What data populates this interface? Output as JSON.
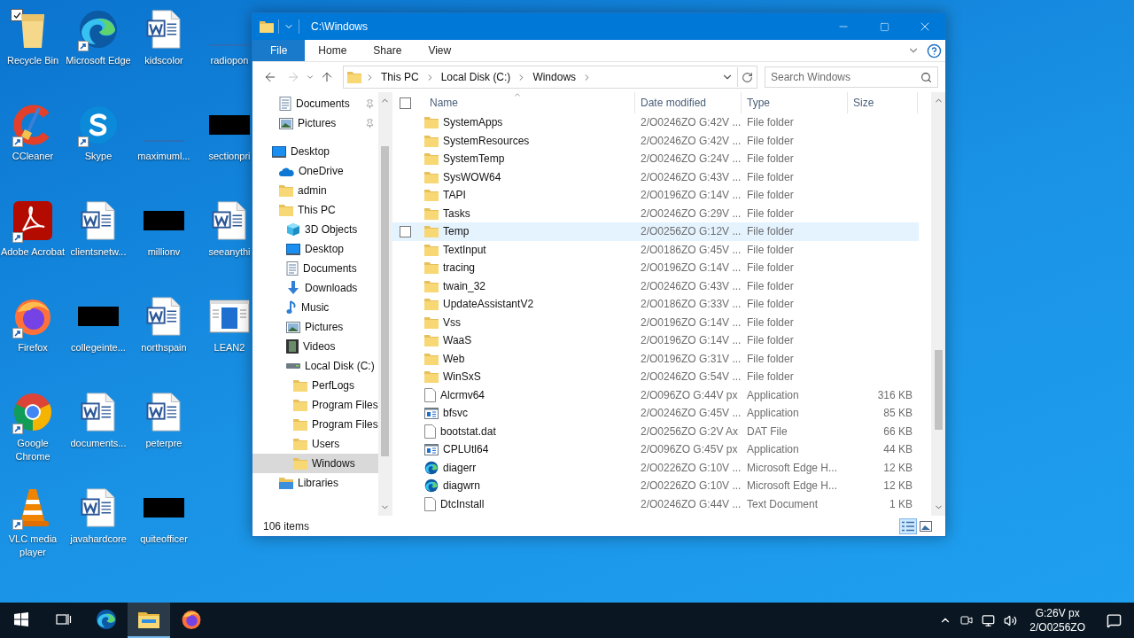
{
  "desktop": {
    "icons": [
      {
        "label": "Recycle Bin",
        "kind": "recycle",
        "shortcut": false,
        "checked": true
      },
      {
        "label": "CCleaner",
        "kind": "ccleaner",
        "shortcut": true,
        "checked": false
      },
      {
        "label": "Adobe Acrobat",
        "kind": "acrobat",
        "shortcut": true,
        "checked": false
      },
      {
        "label": "Firefox",
        "kind": "firefox",
        "shortcut": true,
        "checked": false
      },
      {
        "label": "Google Chrome",
        "kind": "chrome",
        "shortcut": true,
        "checked": false
      },
      {
        "label": "VLC media player",
        "kind": "vlc",
        "shortcut": true,
        "checked": false
      },
      {
        "label": "Microsoft Edge",
        "kind": "edge",
        "shortcut": true,
        "checked": false
      },
      {
        "label": "Skype",
        "kind": "skype",
        "shortcut": true,
        "checked": false
      },
      {
        "label": "clientsnetw...",
        "kind": "word",
        "shortcut": false,
        "checked": false
      },
      {
        "label": "collegeinte...",
        "kind": "redacted",
        "shortcut": false,
        "checked": false
      },
      {
        "label": "documents...",
        "kind": "word",
        "shortcut": false,
        "checked": false
      },
      {
        "label": "javahardcore",
        "kind": "word",
        "shortcut": false,
        "checked": false
      },
      {
        "label": "kidscolor",
        "kind": "word",
        "shortcut": false,
        "checked": false
      },
      {
        "label": "maximuml...",
        "kind": "line",
        "shortcut": false,
        "checked": false
      },
      {
        "label": "millionv",
        "kind": "redacted",
        "shortcut": false,
        "checked": false
      },
      {
        "label": "northspain",
        "kind": "word",
        "shortcut": false,
        "checked": false
      },
      {
        "label": "peterpre",
        "kind": "word",
        "shortcut": false,
        "checked": false
      },
      {
        "label": "quiteofficer",
        "kind": "redacted",
        "shortcut": false,
        "checked": false
      },
      {
        "label": "radiopon",
        "kind": "line",
        "shortcut": false,
        "checked": false
      },
      {
        "label": "sectionpri",
        "kind": "redacted",
        "shortcut": false,
        "checked": false
      },
      {
        "label": "seeanythi",
        "kind": "word",
        "shortcut": false,
        "checked": false
      },
      {
        "label": "LEAN2",
        "kind": "lean",
        "shortcut": false,
        "checked": false
      }
    ]
  },
  "explorer": {
    "title": "C:\\Windows",
    "ribbon_tabs": [
      {
        "label": "File",
        "selected": true
      },
      {
        "label": "Home",
        "selected": false
      },
      {
        "label": "Share",
        "selected": false
      },
      {
        "label": "View",
        "selected": false
      }
    ],
    "back": {
      "disabled": false
    },
    "forward": {
      "disabled": true
    },
    "address": {
      "crumbs": [
        "This PC",
        "Local Disk (C:)",
        "Windows"
      ]
    },
    "search": {
      "placeholder": "Search Windows"
    },
    "nav": {
      "pinned": [
        {
          "label": "Documents",
          "kind": "documents",
          "selected": false
        },
        {
          "label": "Pictures",
          "kind": "pictures",
          "selected": false
        }
      ],
      "tree": [
        {
          "label": "Desktop",
          "kind": "desktop",
          "selected": false,
          "children": [
            {
              "label": "OneDrive",
              "kind": "onedrive",
              "selected": false
            },
            {
              "label": "admin",
              "kind": "folder",
              "selected": false
            },
            {
              "label": "This PC",
              "kind": "folder",
              "selected": false,
              "children": [
                {
                  "label": "3D Objects",
                  "kind": "cube",
                  "selected": false
                },
                {
                  "label": "Desktop",
                  "kind": "desktop",
                  "selected": false
                },
                {
                  "label": "Documents",
                  "kind": "documents",
                  "selected": false
                },
                {
                  "label": "Downloads",
                  "kind": "downloads",
                  "selected": false
                },
                {
                  "label": "Music",
                  "kind": "music",
                  "selected": false
                },
                {
                  "label": "Pictures",
                  "kind": "pictures",
                  "selected": false
                },
                {
                  "label": "Videos",
                  "kind": "videos",
                  "selected": false
                },
                {
                  "label": "Local Disk (C:)",
                  "kind": "drive",
                  "selected": false,
                  "children": [
                    {
                      "label": "PerfLogs",
                      "kind": "folder",
                      "selected": false
                    },
                    {
                      "label": "Program Files",
                      "kind": "folder",
                      "selected": false
                    },
                    {
                      "label": "Program Files",
                      "kind": "folder",
                      "selected": false
                    },
                    {
                      "label": "Users",
                      "kind": "folder",
                      "selected": false
                    },
                    {
                      "label": "Windows",
                      "kind": "folder",
                      "selected": true
                    }
                  ]
                }
              ]
            },
            {
              "label": "Libraries",
              "kind": "libraries",
              "selected": false
            }
          ]
        }
      ]
    },
    "select_all": {
      "checked": false
    },
    "columns": [
      {
        "label": "Name",
        "sorted": true
      },
      {
        "label": "Date modified",
        "sorted": false
      },
      {
        "label": "Type",
        "sorted": false
      },
      {
        "label": "Size",
        "sorted": false
      }
    ],
    "rows": [
      {
        "name": "SystemApps",
        "date": "2/O0246ZO G:42V ...",
        "type": "File folder",
        "kind": "folder",
        "highlighted": false
      },
      {
        "name": "SystemResources",
        "date": "2/O0246ZO G:42V ...",
        "type": "File folder",
        "kind": "folder",
        "highlighted": false
      },
      {
        "name": "SystemTemp",
        "date": "2/O0246ZO G:24V ...",
        "type": "File folder",
        "kind": "folder",
        "highlighted": false
      },
      {
        "name": "SysWOW64",
        "date": "2/O0246ZO G:43V ...",
        "type": "File folder",
        "kind": "folder",
        "highlighted": false
      },
      {
        "name": "TAPI",
        "date": "2/O0196ZO G:14V ...",
        "type": "File folder",
        "kind": "folder",
        "highlighted": false
      },
      {
        "name": "Tasks",
        "date": "2/O0246ZO G:29V ...",
        "type": "File folder",
        "kind": "folder",
        "highlighted": false
      },
      {
        "name": "Temp",
        "date": "2/O0256ZO G:12V ...",
        "type": "File folder",
        "kind": "folder",
        "highlighted": true
      },
      {
        "name": "TextInput",
        "date": "2/O0186ZO G:45V ...",
        "type": "File folder",
        "kind": "folder",
        "highlighted": false
      },
      {
        "name": "tracing",
        "date": "2/O0196ZO G:14V ...",
        "type": "File folder",
        "kind": "folder",
        "highlighted": false
      },
      {
        "name": "twain_32",
        "date": "2/O0246ZO G:43V ...",
        "type": "File folder",
        "kind": "folder",
        "highlighted": false
      },
      {
        "name": "UpdateAssistantV2",
        "date": "2/O0186ZO G:33V ...",
        "type": "File folder",
        "kind": "folder",
        "highlighted": false
      },
      {
        "name": "Vss",
        "date": "2/O0196ZO G:14V ...",
        "type": "File folder",
        "kind": "folder",
        "highlighted": false
      },
      {
        "name": "WaaS",
        "date": "2/O0196ZO G:14V ...",
        "type": "File folder",
        "kind": "folder",
        "highlighted": false
      },
      {
        "name": "Web",
        "date": "2/O0196ZO G:31V ...",
        "type": "File folder",
        "kind": "folder",
        "highlighted": false
      },
      {
        "name": "WinSxS",
        "date": "2/O0246ZO G:54V ...",
        "type": "File folder",
        "kind": "folder",
        "highlighted": false
      },
      {
        "name": "Alcrmv64",
        "date": "2/O096ZO G:44V px",
        "type": "Application",
        "size": "316 KB",
        "kind": "file",
        "highlighted": false
      },
      {
        "name": "bfsvc",
        "date": "2/O0246ZO G:45V ...",
        "type": "Application",
        "size": "85 KB",
        "kind": "app",
        "highlighted": false
      },
      {
        "name": "bootstat.dat",
        "date": "2/O0256ZO G:2V Ax",
        "type": "DAT File",
        "size": "66 KB",
        "kind": "file",
        "highlighted": false
      },
      {
        "name": "CPLUtl64",
        "date": "2/O096ZO G:45V px",
        "type": "Application",
        "size": "44 KB",
        "kind": "app",
        "highlighted": false
      },
      {
        "name": "diagerr",
        "date": "2/O0226ZO G:10V ...",
        "type": "Microsoft Edge H...",
        "size": "12 KB",
        "kind": "edge",
        "highlighted": false
      },
      {
        "name": "diagwrn",
        "date": "2/O0226ZO G:10V ...",
        "type": "Microsoft Edge H...",
        "size": "12 KB",
        "kind": "edge",
        "highlighted": false
      },
      {
        "name": "DtcInstall",
        "date": "2/O0246ZO G:44V ...",
        "type": "Text Document",
        "size": "1 KB",
        "kind": "file",
        "highlighted": false
      }
    ],
    "status": {
      "count": "106 items"
    },
    "views": [
      {
        "kind": "details",
        "selected": true
      },
      {
        "kind": "large-icons",
        "selected": false
      }
    ]
  },
  "taskbar": {
    "apps": [
      {
        "kind": "start",
        "active": false
      },
      {
        "kind": "task-view",
        "active": false
      },
      {
        "kind": "edge",
        "active": false
      },
      {
        "kind": "explorer",
        "active": true
      },
      {
        "kind": "firefox",
        "active": false
      }
    ],
    "tray": {
      "time": "G:26V px",
      "date": "2/O0256ZO"
    }
  }
}
